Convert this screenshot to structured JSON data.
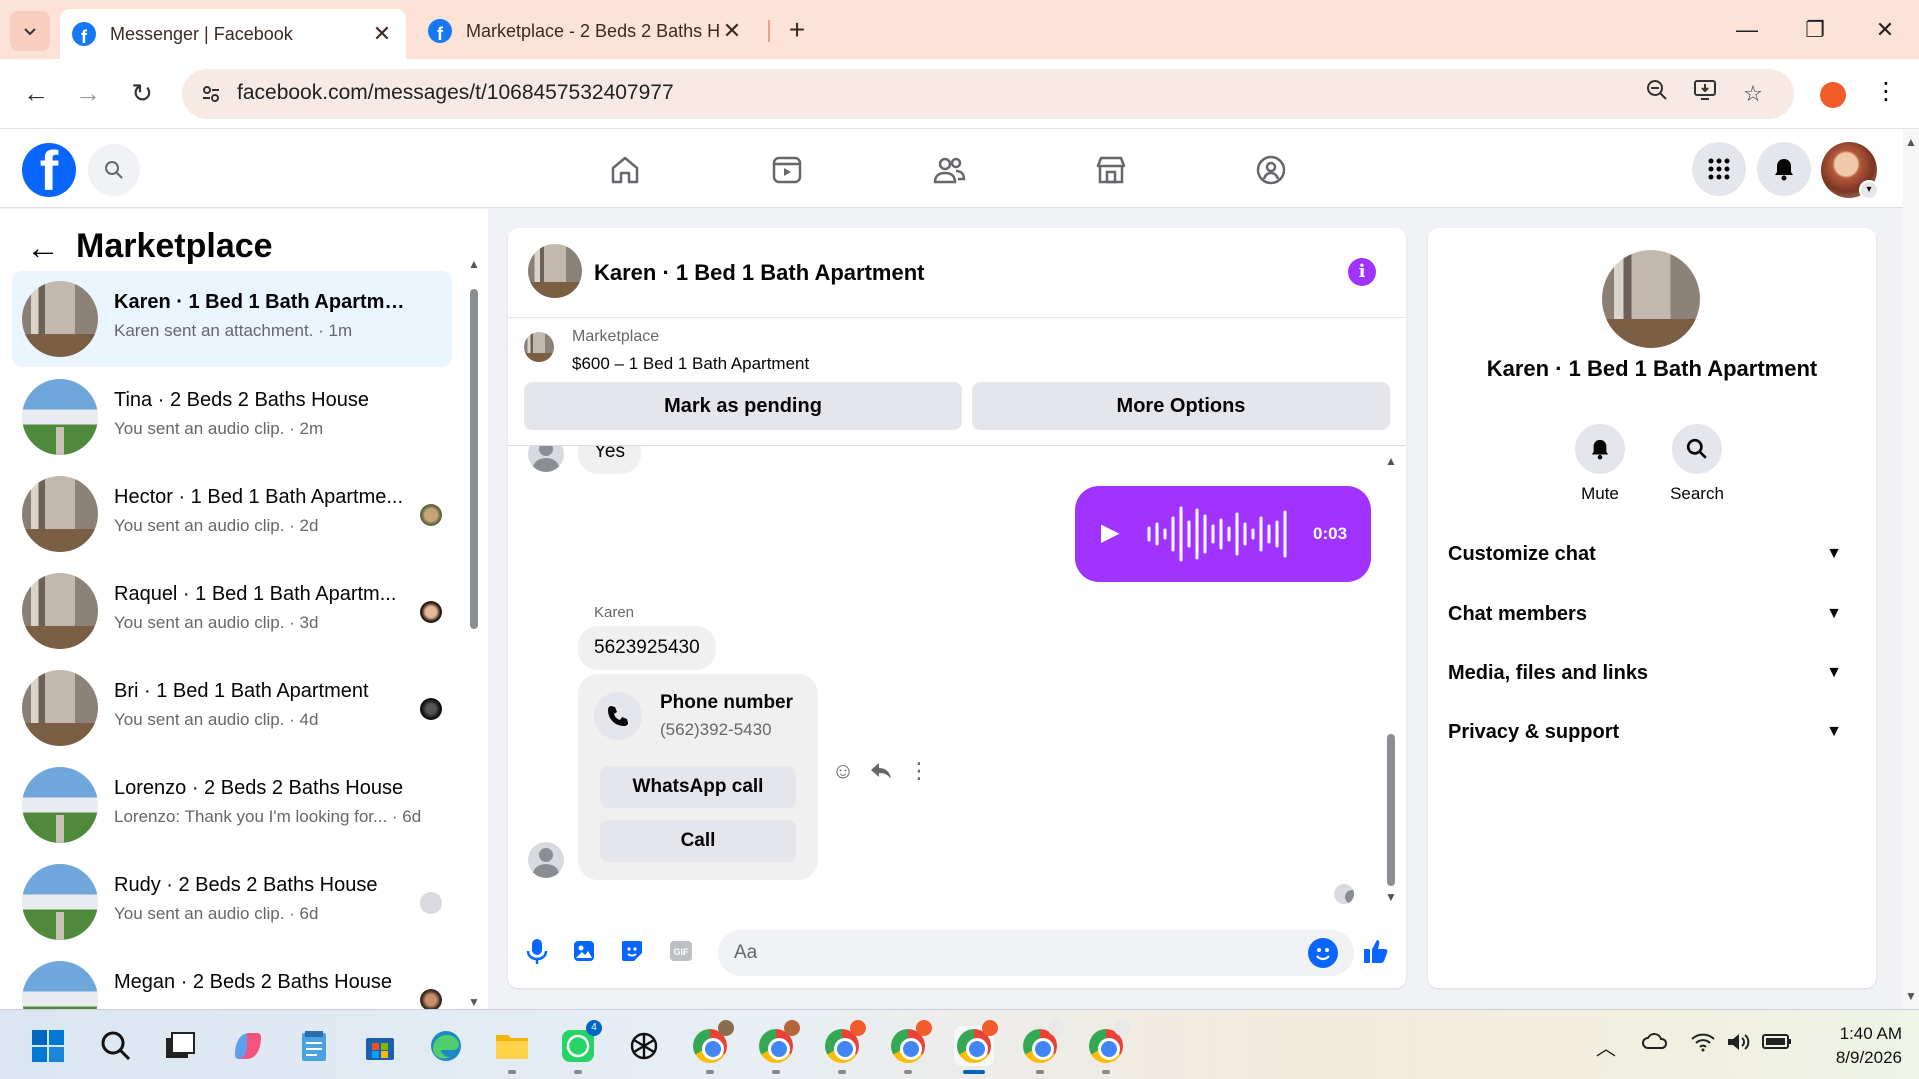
{
  "browser": {
    "tabs": [
      {
        "title": "Messenger | Facebook",
        "active": true
      },
      {
        "title": "Marketplace - 2 Beds 2 Baths H",
        "active": false
      }
    ],
    "url": "facebook.com/messages/t/1068457532407977"
  },
  "left_panel": {
    "title": "Marketplace",
    "conversations": [
      {
        "name": "Karen · 1 Bed 1 Bath Apartment",
        "preview": "Karen sent an attachment. · 1m",
        "thumb": "apartment",
        "selected": true,
        "bold": true
      },
      {
        "name": "Tina · 2 Beds 2 Baths House",
        "preview": "You sent an audio clip. · 2m",
        "thumb": "house",
        "bold": false
      },
      {
        "name": "Hector · 1 Bed 1 Bath Apartme...",
        "preview": "You sent an audio clip. · 2d",
        "thumb": "apartment",
        "bold": false
      },
      {
        "name": "Raquel · 1 Bed 1 Bath Apartm...",
        "preview": "You sent an audio clip. · 3d",
        "thumb": "apartment",
        "bold": false
      },
      {
        "name": "Bri · 1 Bed 1 Bath Apartment",
        "preview": "You sent an audio clip. · 4d",
        "thumb": "apartment",
        "bold": false
      },
      {
        "name": "Lorenzo · 2 Beds 2 Baths House",
        "preview": "Lorenzo: Thank you I'm looking for... · 6d",
        "thumb": "house",
        "bold": false
      },
      {
        "name": "Rudy · 2 Beds 2 Baths House",
        "preview": "You sent an audio clip. · 6d",
        "thumb": "house",
        "bold": false
      },
      {
        "name": "Megan · 2 Beds 2 Baths House",
        "preview": "",
        "thumb": "house",
        "bold": false
      }
    ]
  },
  "chat": {
    "header_name": "Karen · 1 Bed 1 Bath Apartment",
    "marketplace_label": "Marketplace",
    "listing": "$600 – 1 Bed 1 Bath Apartment",
    "mark_pending": "Mark as pending",
    "more_options": "More Options",
    "messages": {
      "yes": "Yes",
      "audio_duration": "0:03",
      "sender": "Karen",
      "phone_text": "5623925430",
      "card_title": "Phone number",
      "card_number": "(562)392-5430",
      "whatsapp_call": "WhatsApp call",
      "call": "Call"
    },
    "composer_placeholder": "Aa"
  },
  "right_panel": {
    "name": "Karen · 1 Bed 1 Bath Apartment",
    "mute": "Mute",
    "search": "Search",
    "sections": [
      "Customize chat",
      "Chat members",
      "Media, files and links",
      "Privacy & support"
    ]
  },
  "taskbar": {
    "time": "1:40 AM",
    "date": "8/9/2026",
    "whatsapp_badge": "4"
  },
  "colors": {
    "fb_blue": "#0866ff",
    "messenger_purple": "#a033ff",
    "selected_row": "#ebf5ff",
    "tab_bar": "#fde3d7"
  }
}
